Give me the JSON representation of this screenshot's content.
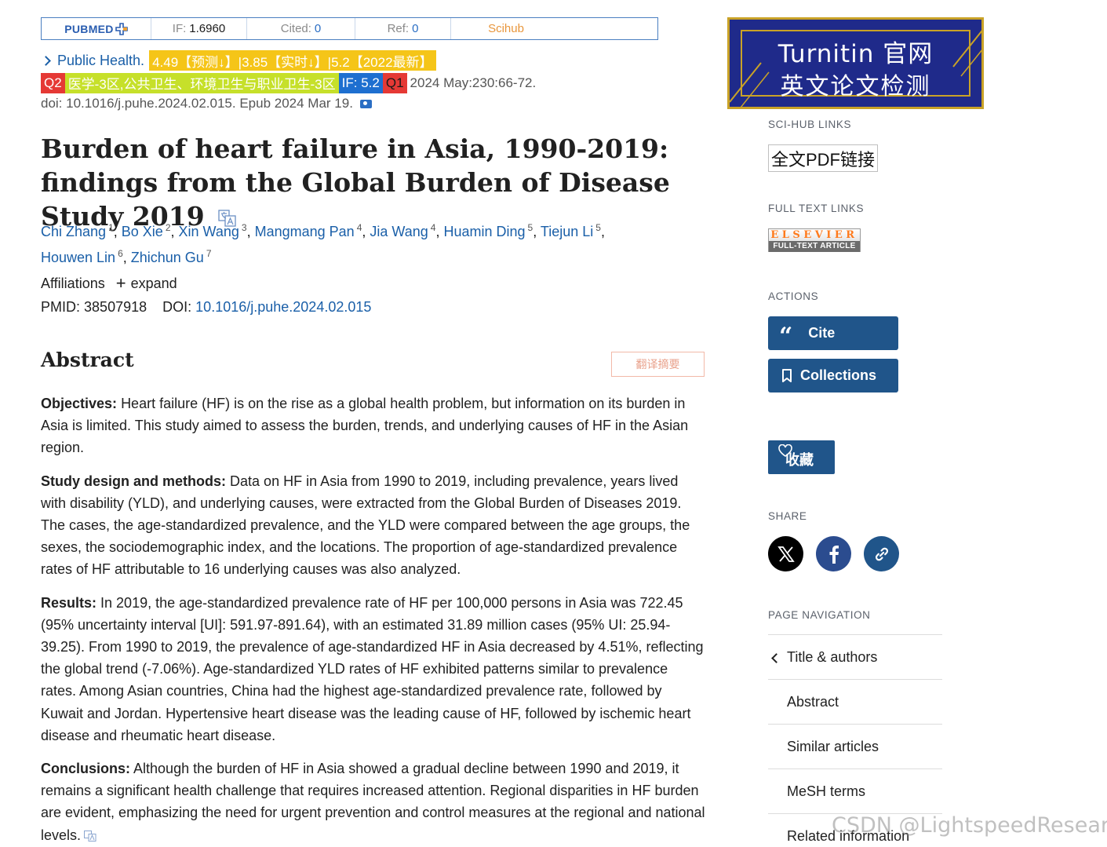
{
  "metrics_bar": {
    "pubmed_label": "PUBMED",
    "if_label": "IF:",
    "if_value": "1.6960",
    "cited_label": "Cited:",
    "cited_value": "0",
    "ref_label": "Ref:",
    "ref_value": "0",
    "scihub_label": "Scihub"
  },
  "journal": {
    "name": "Public Health.",
    "tag_ranking": "4.49【预测↓】|3.85【实时↓】|5.2【2022最新】",
    "tag_q2": "Q2",
    "tag_category": "医学-3区,公共卫生、环境卫生与职业卫生-3区",
    "tag_if": "IF: 5.2",
    "tag_q1": "Q1",
    "citation": "2024 May:230:66-72.",
    "doi_line": "doi: 10.1016/j.puhe.2024.02.015. Epub 2024 Mar 19."
  },
  "article": {
    "title": "Burden of heart failure in Asia, 1990-2019: findings from the Global Burden of Disease Study 2019",
    "authors": [
      {
        "name": "Chi Zhang",
        "aff": "1"
      },
      {
        "name": "Bo Xie",
        "aff": "2"
      },
      {
        "name": "Xin Wang",
        "aff": "3"
      },
      {
        "name": "Mangmang Pan",
        "aff": "4"
      },
      {
        "name": "Jia Wang",
        "aff": "4"
      },
      {
        "name": "Huamin Ding",
        "aff": "5"
      },
      {
        "name": "Tiejun Li",
        "aff": "5"
      },
      {
        "name": "Houwen Lin",
        "aff": "6"
      },
      {
        "name": "Zhichun Gu",
        "aff": "7"
      }
    ],
    "affiliations_label": "Affiliations",
    "expand_label": "expand",
    "pmid_label": "PMID:",
    "pmid_value": "38507918",
    "doi_label": "DOI:",
    "doi_value": "10.1016/j.puhe.2024.02.015"
  },
  "abstract": {
    "heading": "Abstract",
    "translate_button": "翻译摘要",
    "sections": [
      {
        "label": "Objectives:",
        "text": "Heart failure (HF) is on the rise as a global health problem, but information on its burden in Asia is limited. This study aimed to assess the burden, trends, and underlying causes of HF in the Asian region."
      },
      {
        "label": "Study design and methods:",
        "text": "Data on HF in Asia from 1990 to 2019, including prevalence, years lived with disability (YLD), and underlying causes, were extracted from the Global Burden of Diseases 2019. The cases, the age-standardized prevalence, and the YLD were compared between the age groups, the sexes, the sociodemographic index, and the locations. The proportion of age-standardized prevalence rates of HF attributable to 16 underlying causes was also analyzed."
      },
      {
        "label": "Results:",
        "text": "In 2019, the age-standardized prevalence rate of HF per 100,000 persons in Asia was 722.45 (95% uncertainty interval [UI]: 591.97-891.64), with an estimated 31.89 million cases (95% UI: 25.94-39.25). From 1990 to 2019, the prevalence of age-standardized HF in Asia decreased by 4.51%, reflecting the global trend (-7.06%). Age-standardized YLD rates of HF exhibited patterns similar to prevalence rates. Among Asian countries, China had the highest age-standardized prevalence rate, followed by Kuwait and Jordan. Hypertensive heart disease was the leading cause of HF, followed by ischemic heart disease and rheumatic heart disease."
      },
      {
        "label": "Conclusions:",
        "text": "Although the burden of HF in Asia showed a gradual decline between 1990 and 2019, it remains a significant health challenge that requires increased attention. Regional disparities in HF burden are evident, emphasizing the need for urgent prevention and control measures at the regional and national levels."
      }
    ]
  },
  "sidebar": {
    "ad_line1": "Turnitin 官网",
    "ad_line2": "英文论文检测",
    "scihub_links_label": "SCI-HUB LINKS",
    "pdf_link": "全文PDF链接",
    "full_text_links_label": "FULL TEXT LINKS",
    "elsevier_top": "ELSEVIER",
    "elsevier_bottom": "FULL-TEXT ARTICLE",
    "actions_label": "ACTIONS",
    "cite_button": "Cite",
    "collections_button": "Collections",
    "favorite_button": "收藏",
    "share_label": "SHARE",
    "page_navigation_label": "PAGE NAVIGATION",
    "nav_items": [
      "Title & authors",
      "Abstract",
      "Similar articles",
      "MeSH terms",
      "Related information"
    ]
  },
  "watermark": "CSDN @LightspeedResearch",
  "colors": {
    "link_blue": "#1a5fa8",
    "button_blue": "#20558a",
    "tag_yellow": "#f5c518",
    "tag_red": "#e53935",
    "tag_green": "#c6e02a",
    "tag_blue": "#1e6fd0"
  }
}
